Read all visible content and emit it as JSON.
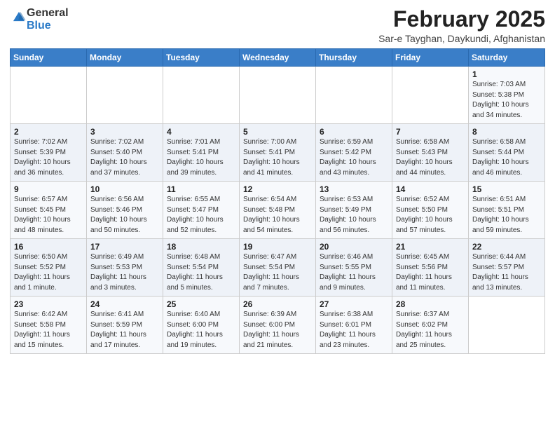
{
  "header": {
    "logo_general": "General",
    "logo_blue": "Blue",
    "title": "February 2025",
    "subtitle": "Sar-e Tayghan, Daykundi, Afghanistan"
  },
  "weekdays": [
    "Sunday",
    "Monday",
    "Tuesday",
    "Wednesday",
    "Thursday",
    "Friday",
    "Saturday"
  ],
  "weeks": [
    [
      {
        "day": "",
        "info": ""
      },
      {
        "day": "",
        "info": ""
      },
      {
        "day": "",
        "info": ""
      },
      {
        "day": "",
        "info": ""
      },
      {
        "day": "",
        "info": ""
      },
      {
        "day": "",
        "info": ""
      },
      {
        "day": "1",
        "info": "Sunrise: 7:03 AM\nSunset: 5:38 PM\nDaylight: 10 hours\nand 34 minutes."
      }
    ],
    [
      {
        "day": "2",
        "info": "Sunrise: 7:02 AM\nSunset: 5:39 PM\nDaylight: 10 hours\nand 36 minutes."
      },
      {
        "day": "3",
        "info": "Sunrise: 7:02 AM\nSunset: 5:40 PM\nDaylight: 10 hours\nand 37 minutes."
      },
      {
        "day": "4",
        "info": "Sunrise: 7:01 AM\nSunset: 5:41 PM\nDaylight: 10 hours\nand 39 minutes."
      },
      {
        "day": "5",
        "info": "Sunrise: 7:00 AM\nSunset: 5:41 PM\nDaylight: 10 hours\nand 41 minutes."
      },
      {
        "day": "6",
        "info": "Sunrise: 6:59 AM\nSunset: 5:42 PM\nDaylight: 10 hours\nand 43 minutes."
      },
      {
        "day": "7",
        "info": "Sunrise: 6:58 AM\nSunset: 5:43 PM\nDaylight: 10 hours\nand 44 minutes."
      },
      {
        "day": "8",
        "info": "Sunrise: 6:58 AM\nSunset: 5:44 PM\nDaylight: 10 hours\nand 46 minutes."
      }
    ],
    [
      {
        "day": "9",
        "info": "Sunrise: 6:57 AM\nSunset: 5:45 PM\nDaylight: 10 hours\nand 48 minutes."
      },
      {
        "day": "10",
        "info": "Sunrise: 6:56 AM\nSunset: 5:46 PM\nDaylight: 10 hours\nand 50 minutes."
      },
      {
        "day": "11",
        "info": "Sunrise: 6:55 AM\nSunset: 5:47 PM\nDaylight: 10 hours\nand 52 minutes."
      },
      {
        "day": "12",
        "info": "Sunrise: 6:54 AM\nSunset: 5:48 PM\nDaylight: 10 hours\nand 54 minutes."
      },
      {
        "day": "13",
        "info": "Sunrise: 6:53 AM\nSunset: 5:49 PM\nDaylight: 10 hours\nand 56 minutes."
      },
      {
        "day": "14",
        "info": "Sunrise: 6:52 AM\nSunset: 5:50 PM\nDaylight: 10 hours\nand 57 minutes."
      },
      {
        "day": "15",
        "info": "Sunrise: 6:51 AM\nSunset: 5:51 PM\nDaylight: 10 hours\nand 59 minutes."
      }
    ],
    [
      {
        "day": "16",
        "info": "Sunrise: 6:50 AM\nSunset: 5:52 PM\nDaylight: 11 hours\nand 1 minute."
      },
      {
        "day": "17",
        "info": "Sunrise: 6:49 AM\nSunset: 5:53 PM\nDaylight: 11 hours\nand 3 minutes."
      },
      {
        "day": "18",
        "info": "Sunrise: 6:48 AM\nSunset: 5:54 PM\nDaylight: 11 hours\nand 5 minutes."
      },
      {
        "day": "19",
        "info": "Sunrise: 6:47 AM\nSunset: 5:54 PM\nDaylight: 11 hours\nand 7 minutes."
      },
      {
        "day": "20",
        "info": "Sunrise: 6:46 AM\nSunset: 5:55 PM\nDaylight: 11 hours\nand 9 minutes."
      },
      {
        "day": "21",
        "info": "Sunrise: 6:45 AM\nSunset: 5:56 PM\nDaylight: 11 hours\nand 11 minutes."
      },
      {
        "day": "22",
        "info": "Sunrise: 6:44 AM\nSunset: 5:57 PM\nDaylight: 11 hours\nand 13 minutes."
      }
    ],
    [
      {
        "day": "23",
        "info": "Sunrise: 6:42 AM\nSunset: 5:58 PM\nDaylight: 11 hours\nand 15 minutes."
      },
      {
        "day": "24",
        "info": "Sunrise: 6:41 AM\nSunset: 5:59 PM\nDaylight: 11 hours\nand 17 minutes."
      },
      {
        "day": "25",
        "info": "Sunrise: 6:40 AM\nSunset: 6:00 PM\nDaylight: 11 hours\nand 19 minutes."
      },
      {
        "day": "26",
        "info": "Sunrise: 6:39 AM\nSunset: 6:00 PM\nDaylight: 11 hours\nand 21 minutes."
      },
      {
        "day": "27",
        "info": "Sunrise: 6:38 AM\nSunset: 6:01 PM\nDaylight: 11 hours\nand 23 minutes."
      },
      {
        "day": "28",
        "info": "Sunrise: 6:37 AM\nSunset: 6:02 PM\nDaylight: 11 hours\nand 25 minutes."
      },
      {
        "day": "",
        "info": ""
      }
    ]
  ]
}
